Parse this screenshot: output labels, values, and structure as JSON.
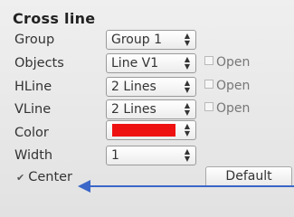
{
  "panel": {
    "title": "Cross line",
    "rows": {
      "group": {
        "label": "Group",
        "value": "Group 1"
      },
      "objects": {
        "label": "Objects",
        "value": "Line V1",
        "open_label": "Open",
        "open_checked": false
      },
      "hline": {
        "label": "HLine",
        "value": "2 Lines",
        "open_label": "Open",
        "open_checked": false
      },
      "vline": {
        "label": "VLine",
        "value": "2 Lines",
        "open_label": "Open",
        "open_checked": false
      },
      "color": {
        "label": "Color",
        "value_hex": "#ee1111"
      },
      "width": {
        "label": "Width",
        "value": "1"
      }
    },
    "center": {
      "label": "Center",
      "checked": true
    },
    "default_button": "Default",
    "accent": "#3a67c8"
  }
}
